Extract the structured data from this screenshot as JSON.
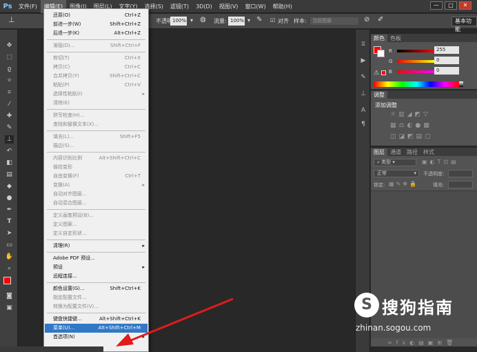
{
  "app": {
    "logo": "Ps"
  },
  "menubar": {
    "items": [
      "文件(F)",
      "编辑(E)",
      "图像(I)",
      "图层(L)",
      "文字(Y)",
      "选择(S)",
      "滤镜(T)",
      "3D(D)",
      "视图(V)",
      "窗口(W)",
      "帮助(H)"
    ],
    "active": "编辑(E)"
  },
  "window_controls": {
    "minimize": "—",
    "restore": "□",
    "close": "✕"
  },
  "options_bar": {
    "opacity_label": "不透明度:",
    "opacity_value": "100%",
    "flow_label": "流量:",
    "flow_value": "100%",
    "align_label": "对齐",
    "sample_label": "样本:",
    "sample_value": "当前图层",
    "workspace": "基本功能"
  },
  "color_panel": {
    "tabs": [
      "颜色",
      "色板"
    ],
    "r_label": "R",
    "r_value": "255",
    "g_label": "G",
    "g_value": "0",
    "b_label": "B",
    "b_value": "0",
    "foreground": "#ff0000"
  },
  "adjust_panel": {
    "tab": "调整",
    "title": "添加调整"
  },
  "layers_panel": {
    "tabs": [
      "图层",
      "通道",
      "路径",
      "样式"
    ],
    "kind_label": "类型",
    "blend_mode": "正常",
    "opacity_label": "不透明度:",
    "lock_label": "锁定:",
    "fill_label": "填充:"
  },
  "edit_menu": {
    "items": [
      {
        "label": "还原(O)",
        "shortcut": "Ctrl+Z",
        "disabled": false
      },
      {
        "label": "前进一步(W)",
        "shortcut": "Shift+Ctrl+Z",
        "disabled": false
      },
      {
        "label": "后退一步(K)",
        "shortcut": "Alt+Ctrl+Z",
        "disabled": false
      },
      {
        "label": "渐隐(D)...",
        "shortcut": "Shift+Ctrl+F",
        "disabled": true
      },
      {
        "label": "剪切(T)",
        "shortcut": "Ctrl+X",
        "disabled": true
      },
      {
        "label": "拷贝(C)",
        "shortcut": "Ctrl+C",
        "disabled": true
      },
      {
        "label": "合并拷贝(Y)",
        "shortcut": "Shift+Ctrl+C",
        "disabled": true
      },
      {
        "label": "粘贴(P)",
        "shortcut": "Ctrl+V",
        "disabled": true
      },
      {
        "label": "选择性粘贴(I)",
        "shortcut": "",
        "disabled": true,
        "submenu": true
      },
      {
        "label": "清除(E)",
        "shortcut": "",
        "disabled": true
      },
      {
        "label": "拼写检查(H)...",
        "shortcut": "",
        "disabled": true
      },
      {
        "label": "查找和替换文本(X)...",
        "shortcut": "",
        "disabled": true
      },
      {
        "label": "填充(L)...",
        "shortcut": "Shift+F5",
        "disabled": true
      },
      {
        "label": "描边(S)...",
        "shortcut": "",
        "disabled": true
      },
      {
        "label": "内容识别比例",
        "shortcut": "Alt+Shift+Ctrl+C",
        "disabled": true
      },
      {
        "label": "操控变形",
        "shortcut": "",
        "disabled": true
      },
      {
        "label": "自由变换(F)",
        "shortcut": "Ctrl+T",
        "disabled": true
      },
      {
        "label": "变换(A)",
        "shortcut": "",
        "disabled": true,
        "submenu": true
      },
      {
        "label": "自动对齐图层...",
        "shortcut": "",
        "disabled": true
      },
      {
        "label": "自动混合图层...",
        "shortcut": "",
        "disabled": true
      },
      {
        "label": "定义画笔预设(B)...",
        "shortcut": "",
        "disabled": true
      },
      {
        "label": "定义图案...",
        "shortcut": "",
        "disabled": true
      },
      {
        "label": "定义自定形状...",
        "shortcut": "",
        "disabled": true
      },
      {
        "label": "清理(R)",
        "shortcut": "",
        "disabled": false,
        "submenu": true
      },
      {
        "label": "Adobe PDF 预设...",
        "shortcut": "",
        "disabled": false
      },
      {
        "label": "预设",
        "shortcut": "",
        "disabled": false,
        "submenu": true
      },
      {
        "label": "远程连接...",
        "shortcut": "",
        "disabled": false
      },
      {
        "label": "颜色设置(G)...",
        "shortcut": "Shift+Ctrl+K",
        "disabled": false
      },
      {
        "label": "指定配置文件...",
        "shortcut": "",
        "disabled": true
      },
      {
        "label": "转换为配置文件(V)...",
        "shortcut": "",
        "disabled": true
      },
      {
        "label": "键盘快捷键...",
        "shortcut": "Alt+Shift+Ctrl+K",
        "disabled": false
      },
      {
        "label": "菜单(U)...",
        "shortcut": "Alt+Shift+Ctrl+M",
        "disabled": false,
        "highlight": true
      },
      {
        "label": "首选项(N)",
        "shortcut": "",
        "disabled": false,
        "submenu": true
      }
    ]
  },
  "watermark": {
    "logo": "S",
    "title": "搜狗指南",
    "url": "zhinan.sogou.com"
  }
}
